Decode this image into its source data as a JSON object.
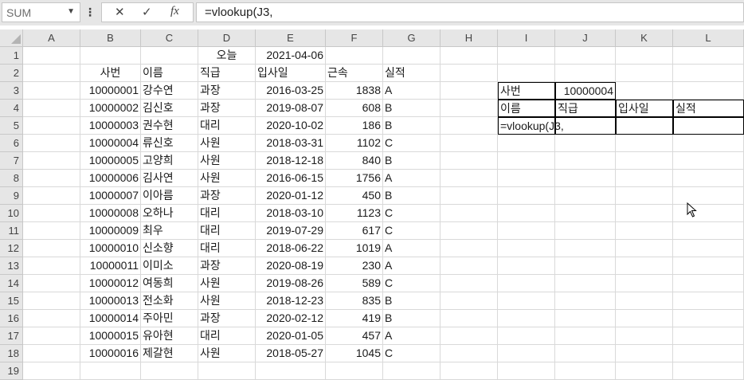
{
  "formula_bar": {
    "name_box": "SUM",
    "dots": "⋮",
    "cancel_icon": "✕",
    "enter_icon": "✓",
    "fx_icon": "fx",
    "formula": "=vlookup(J3,"
  },
  "columns": [
    "A",
    "B",
    "C",
    "D",
    "E",
    "F",
    "G",
    "H",
    "I",
    "J",
    "K",
    "L"
  ],
  "rows": [
    "1",
    "2",
    "3",
    "4",
    "5",
    "6",
    "7",
    "8",
    "9",
    "10",
    "11",
    "12",
    "13",
    "14",
    "15",
    "16",
    "17",
    "18",
    "19"
  ],
  "header_row1": {
    "D": "오늘",
    "E": "2021-04-06"
  },
  "table_headers": {
    "B": "사번",
    "C": "이름",
    "D": "직급",
    "E": "입사일",
    "F": "근속",
    "G": "실적"
  },
  "records": [
    [
      "10000001",
      "강수연",
      "과장",
      "2016-03-25",
      "1838",
      "A"
    ],
    [
      "10000002",
      "김신호",
      "과장",
      "2019-08-07",
      "608",
      "B"
    ],
    [
      "10000003",
      "권수현",
      "대리",
      "2020-10-02",
      "186",
      "B"
    ],
    [
      "10000004",
      "류신호",
      "사원",
      "2018-03-31",
      "1102",
      "C"
    ],
    [
      "10000005",
      "고양희",
      "사원",
      "2018-12-18",
      "840",
      "B"
    ],
    [
      "10000006",
      "김사연",
      "사원",
      "2016-06-15",
      "1756",
      "A"
    ],
    [
      "10000007",
      "이아름",
      "과장",
      "2020-01-12",
      "450",
      "B"
    ],
    [
      "10000008",
      "오하나",
      "대리",
      "2018-03-10",
      "1123",
      "C"
    ],
    [
      "10000009",
      "최우",
      "대리",
      "2019-07-29",
      "617",
      "C"
    ],
    [
      "10000010",
      "신소향",
      "대리",
      "2018-06-22",
      "1019",
      "A"
    ],
    [
      "10000011",
      "이미소",
      "과장",
      "2020-08-19",
      "230",
      "A"
    ],
    [
      "10000012",
      "여동희",
      "사원",
      "2019-08-26",
      "589",
      "C"
    ],
    [
      "10000013",
      "전소화",
      "사원",
      "2018-12-23",
      "835",
      "B"
    ],
    [
      "10000014",
      "주아민",
      "과장",
      "2020-02-12",
      "419",
      "B"
    ],
    [
      "10000015",
      "유아현",
      "대리",
      "2020-01-05",
      "457",
      "A"
    ],
    [
      "10000016",
      "제갈현",
      "사원",
      "2018-05-27",
      "1045",
      "C"
    ]
  ],
  "lookup": {
    "id_label": "사번",
    "id_value": "10000004",
    "headers": [
      "이름",
      "직급",
      "입사일",
      "실적"
    ],
    "editing": "=vlookup(J3,"
  }
}
